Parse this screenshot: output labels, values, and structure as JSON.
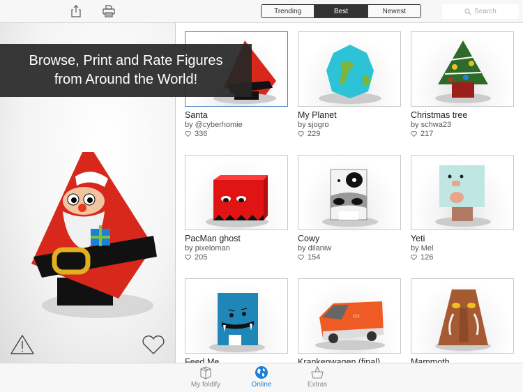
{
  "toolbar": {
    "share_icon": "share-icon",
    "print_icon": "printer-icon",
    "segments": [
      {
        "label": "Trending",
        "active": false
      },
      {
        "label": "Best",
        "active": true
      },
      {
        "label": "Newest",
        "active": false
      }
    ],
    "search_placeholder": "Search",
    "search_icon": "magnifier-icon"
  },
  "banner": {
    "line1": "Browse, Print and Rate Figures",
    "line2": "from Around the World!"
  },
  "detail": {
    "figure": "Santa",
    "report_icon": "warning-icon",
    "like_icon": "heart-icon"
  },
  "figures": [
    {
      "title": "Santa",
      "author": "by @cyberhomie",
      "likes": "336",
      "selected": true
    },
    {
      "title": "My Planet",
      "author": "by sjogro",
      "likes": "229"
    },
    {
      "title": "Christmas tree",
      "author": "by schwa23",
      "likes": "217"
    },
    {
      "title": "PacMan ghost",
      "author": "by pixeloman",
      "likes": "205"
    },
    {
      "title": "Cowy",
      "author": "by dilaniw",
      "likes": "154"
    },
    {
      "title": "Yeti",
      "author": "by Mel",
      "likes": "126"
    },
    {
      "title": "Feed Me",
      "author": "",
      "likes": ""
    },
    {
      "title": "Krankenwagen (final)",
      "author": "",
      "likes": ""
    },
    {
      "title": "Mammoth",
      "author": "",
      "likes": ""
    }
  ],
  "tabs": [
    {
      "label": "My foldify",
      "icon": "box-icon",
      "active": false
    },
    {
      "label": "Online",
      "icon": "globe-icon",
      "active": true
    },
    {
      "label": "Extras",
      "icon": "basket-icon",
      "active": false
    }
  ],
  "colors": {
    "accent": "#1e7fd8",
    "segment_active": "#333333",
    "selection_border": "#4a7fc4"
  }
}
